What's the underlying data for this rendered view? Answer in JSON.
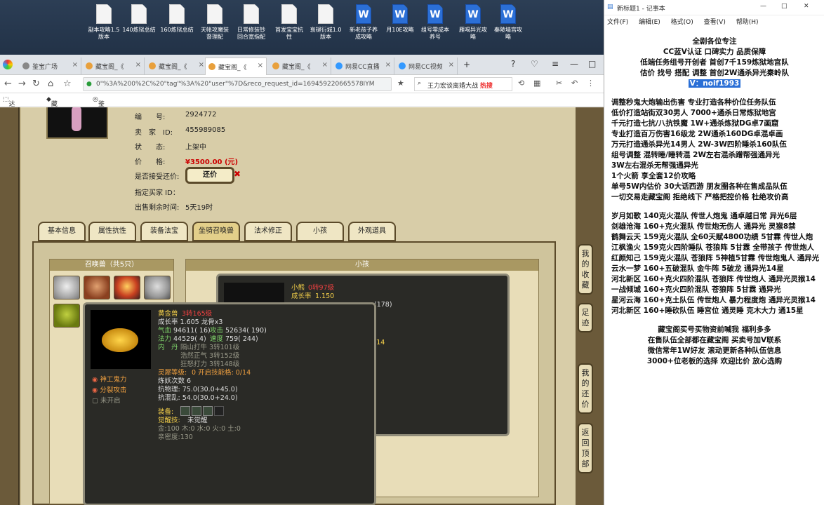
{
  "desktop": {
    "icons": [
      "副本攻略1.5\n版本",
      "140炼狱总结",
      "160炼狱总结",
      "天帐攻魔装\n督理配",
      "日常修装钞\n回合宽指配",
      "首发宝宝抗\n性",
      "衰褪衍城1.0\n版本",
      "新老孩子养\n成攻略",
      "月10E攻略",
      "组号零成本\n养号",
      "雁喝异光攻\n略",
      "秦陵墙宫攻\n略"
    ]
  },
  "browser": {
    "tabs": [
      "鉴宝广场",
      "藏宝阁_《",
      "藏宝阁_《",
      "藏宝阁_《",
      "网易CC直播",
      "网易CC视频"
    ],
    "url": "0\"%3A%200%2C%20\"tag\"%3A%20\"user\"%7D&reco_request_id=169459220665578IYM",
    "search": "王力宏谈离婚大战",
    "hot": "热搜",
    "bookmarks": [
      "达人后台",
      "藏宝阁_《",
      "鉴宝广场"
    ]
  },
  "item": {
    "labels": {
      "id": "编　　号:",
      "seller": "卖　家　ID:",
      "status": "状　　态:",
      "price": "价　　格:",
      "accept": "是否接受还价:",
      "buyer": "指定买家 ID：",
      "remaining": "出售剩余时间:"
    },
    "id": "2924772",
    "seller": "455989085",
    "status": "上架中",
    "price": "¥3500.00 (元)",
    "remaining": "5天19时",
    "counter_btn": "还价"
  },
  "game_tabs": [
    "基本信息",
    "属性抗性",
    "装备法宝",
    "坐骑召唤兽",
    "法术修正",
    "小孩",
    "外观道具"
  ],
  "summon": {
    "header": "召唤兽（共5只）"
  },
  "xiaohai": {
    "header": "小孩"
  },
  "side_buttons": [
    "我的收藏",
    "足迹",
    "我的还价",
    "返回顶部"
  ],
  "back_popup": {
    "name": "小熊",
    "level": "0转97级",
    "growth_label": "成长率",
    "growth": "1.150",
    "partial": "(178)",
    "partial2": "/14"
  },
  "pet_popup": {
    "name": "黄金兽",
    "level": "3转165级",
    "growth": "成长率 1.605 龙骨x3",
    "hp_l": "气血",
    "hp": "94611( 16)",
    "atk_l": "攻击",
    "atk": "52634( 190)",
    "mp_l": "法力",
    "mp": "44529( 4)",
    "spd_l": "速度",
    "spd": "759( 244)",
    "neidan_l": "内　丹",
    "nd1": "隔山打牛 3转101级",
    "nd2": "浩然正气 3转152级",
    "nd3": "狂怒打力 3转148级",
    "lingxi": "灵犀等级:",
    "lingxi2": "0 开启技能格: 0/14",
    "lianyao": "炼妖次数 6",
    "kwl": "抗物理: 75.0(30.0+45.0)",
    "kfl": "抗混乱: 54.0(30.0+24.0)",
    "skills": [
      "神工鬼力",
      "分裂攻击",
      "未开启"
    ],
    "equip_l": "装备:",
    "awake_l": "觉醒技:",
    "awake": "未觉醒",
    "elem": "金:100 木:0 水:0 火:0 土:0",
    "intimacy": "亲密度:130"
  },
  "notepad": {
    "title": "新标题1 - 记事本",
    "menu": [
      "文件(F)",
      "编辑(E)",
      "格式(O)",
      "查看(V)",
      "帮助(H)"
    ],
    "lines": [
      "全剧各位专注",
      "CC蓝V认证 口碑实力 品质保障",
      "低端任务组号开创者          首创7千159炼狱地宫队",
      "估价 找号 搭配 调整          首创2W通杀异光秦岭队",
      "V：noif1993",
      "",
      "调整秒鬼大炮输出伤害          专业打造各种价位任务队伍",
      "低价打造站街双30男人             7000+通杀日常炼狱地宫",
      "千元打造七抗/八抗铁魔            1W+通杀炼狱DG卓7画窟",
      "专业打造百万伤害16级龙        2W通杀160DG卓混卓画",
      "万元打造通杀异光14男人        2W-3W四阶睡杀160队伍",
      "组号调整 混转睡/睡转混          2W左右混杀蹭帮强通异光",
      "                                           3W左右混杀无帮强通异光",
      "1个火箭 享全套12价攻略",
      "单号5W内估价 30大话西游        朋友圈各种在售成品队伍",
      "一切交易走藏宝阁 拒绝线下     严格把控价格 杜绝攻价高",
      "",
      "岁月如歌 140克火混队 传世人炮鬼 通卓越日常 异光6层",
      "剑雄沧海 160+克火混队 传世炮无伤人 通异光 灵猴8禁",
      "鹤舞云天 159克火混队 全60天赋4800功绩 5甘霖 传世人炮",
      "江枫渔火 159克火四阶睡队 苍狼阵 5甘霖 全带孩子 传世炮人",
      "红颜知己 159克火混队 苍狼阵 5神植5甘霖 传世炮鬼人 通异光",
      "云水一梦 160+五破混队 金牛阵 5破龙 通异光14星",
      "河北新区 160+克火四阶混队 苍狼阵 传世炮人 通异光灵猴14",
      "一战倾城 160+克火四阶混队 苍狼阵 5甘霖 通异光",
      "星河云海 160+克土队伍 传世炮人 暴力程度炮 通异光灵猴14",
      "河北新区 160+睡砍队伍 睡宫位 通灵睡 克木大力 通15星",
      "",
      "藏宝阁买号买物资前喊我 福利多多",
      "在售队伍全部都在藏宝阁 买卖号加V联系",
      "微信常年1W好友 滚动更新各种队伍信息",
      "3000+位老板的选择 欢迎比价 放心选购"
    ]
  }
}
